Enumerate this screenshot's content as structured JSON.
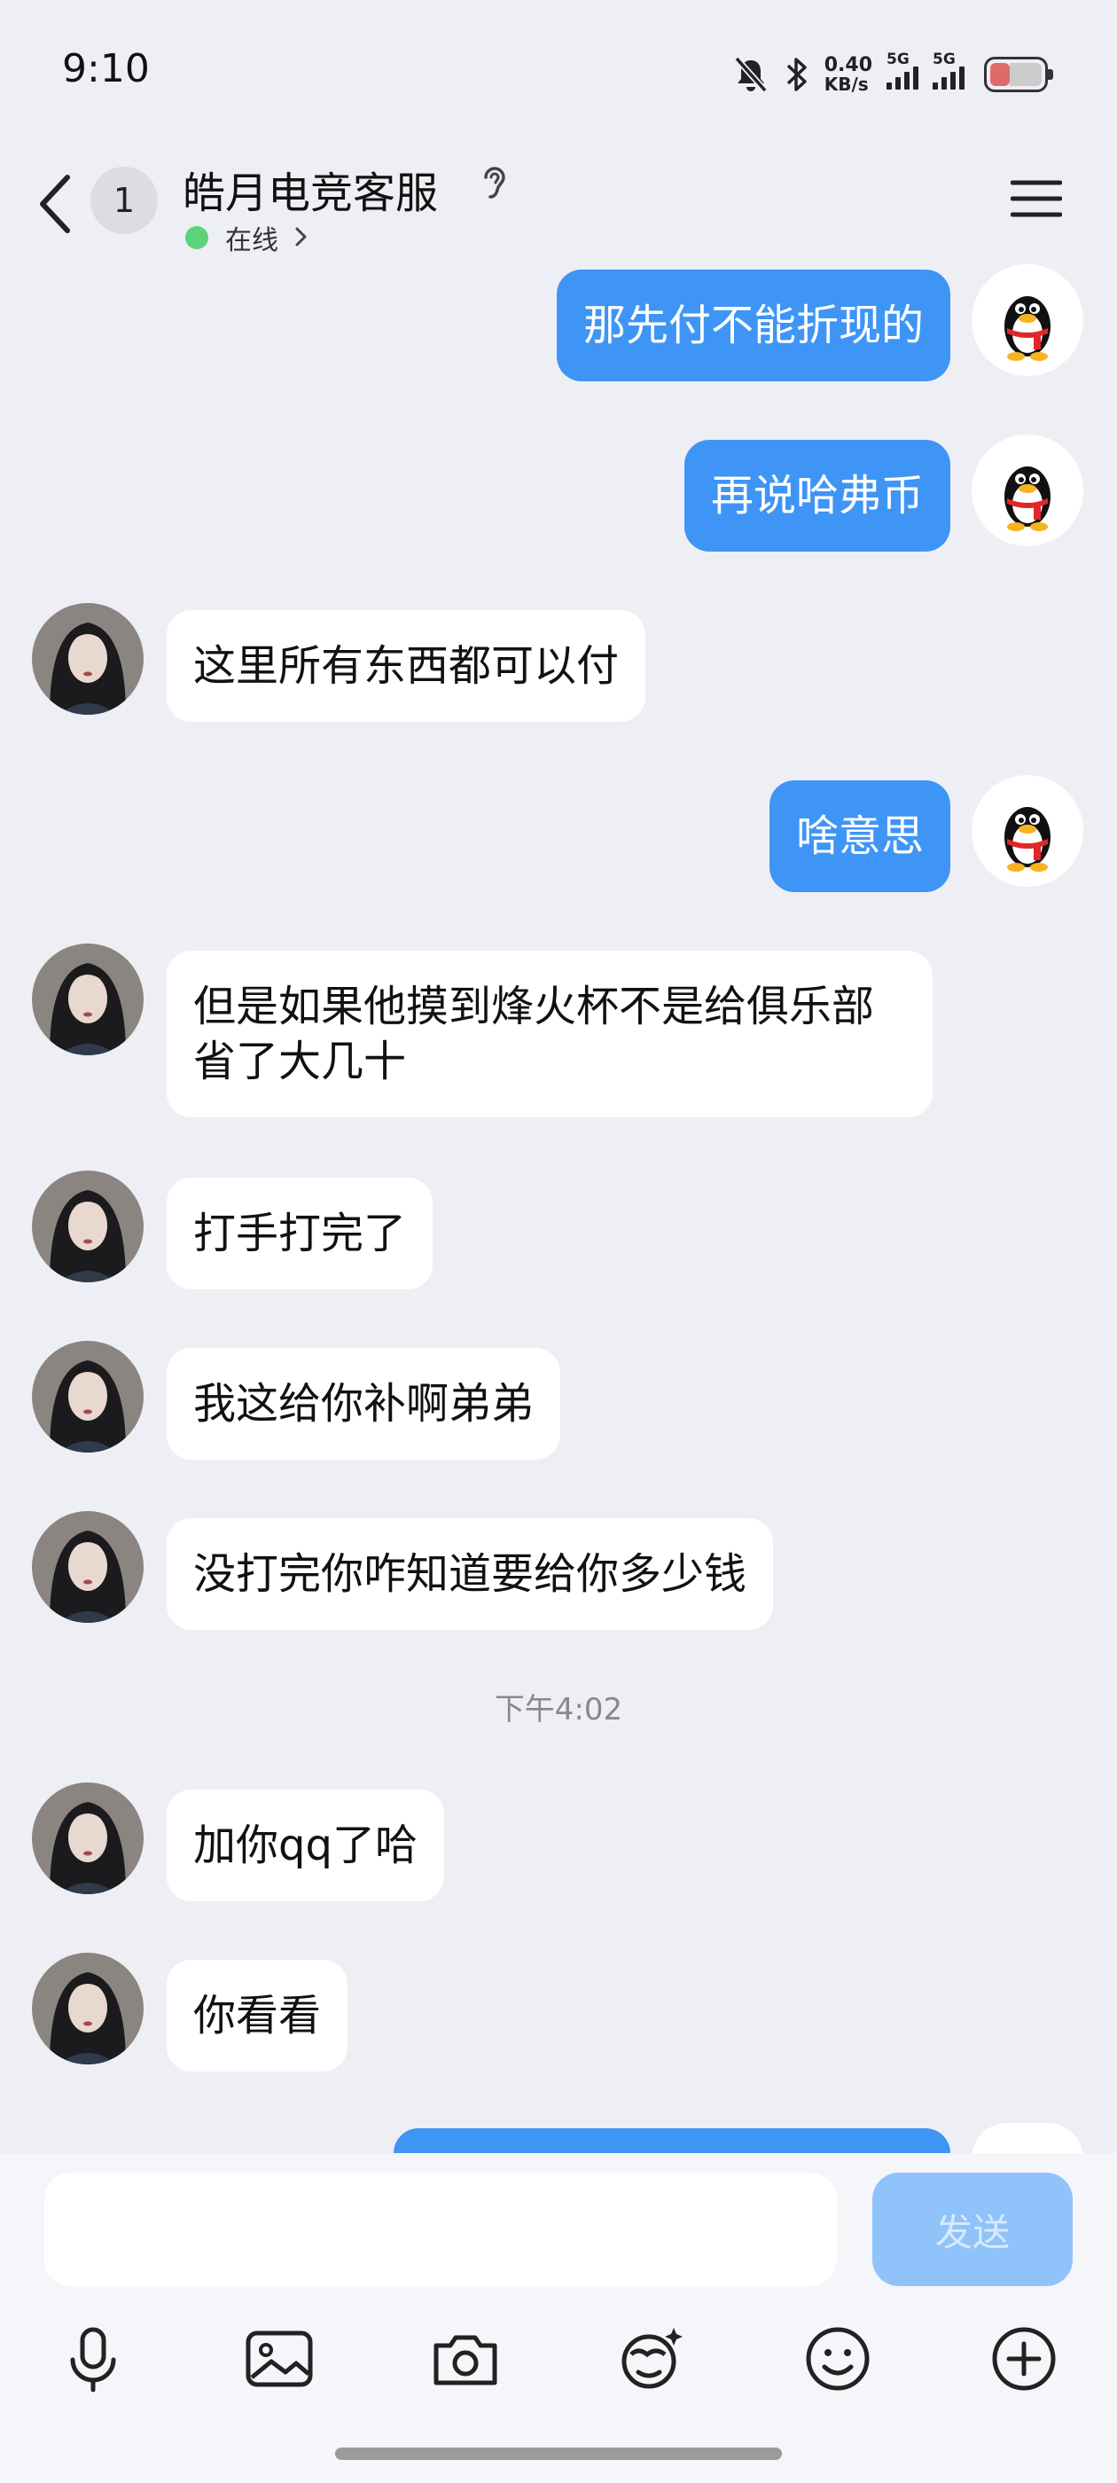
{
  "status_bar": {
    "time": "9:10",
    "net_speed_value": "0.40",
    "net_speed_unit": "KB/s",
    "sim1_label": "5G",
    "sim2_label": "5G",
    "battery_level": 0.3
  },
  "header": {
    "back_badge": "1",
    "title": "皓月电竞客服",
    "status": "在线"
  },
  "messages": [
    {
      "side": "out",
      "text": "那先付不能折现的"
    },
    {
      "side": "out",
      "text": "再说哈弗币"
    },
    {
      "side": "in",
      "text": "这里所有东西都可以付"
    },
    {
      "side": "out",
      "text": "啥意思"
    },
    {
      "side": "in",
      "text": "但是如果他摸到烽火杯不是给俱乐部省了大几十"
    },
    {
      "side": "in",
      "text": "打手打完了"
    },
    {
      "side": "in",
      "text": "我这给你补啊弟弟"
    },
    {
      "side": "in",
      "text": "没打完你咋知道要给你多少钱"
    },
    {
      "side": "in",
      "text": "加你qq了哈"
    },
    {
      "side": "in",
      "text": "你看看"
    }
  ],
  "time_separator": "下午4:02",
  "input": {
    "placeholder": "",
    "send_label": "发送"
  },
  "colors": {
    "outgoing_bubble": "#3e95f6",
    "incoming_bubble": "#ffffff",
    "background": "#eeeff4",
    "online_dot": "#5dd27a"
  },
  "toolbar_icons": [
    "microphone-icon",
    "image-icon",
    "camera-icon",
    "sticker-icon",
    "emoji-icon",
    "plus-icon"
  ]
}
